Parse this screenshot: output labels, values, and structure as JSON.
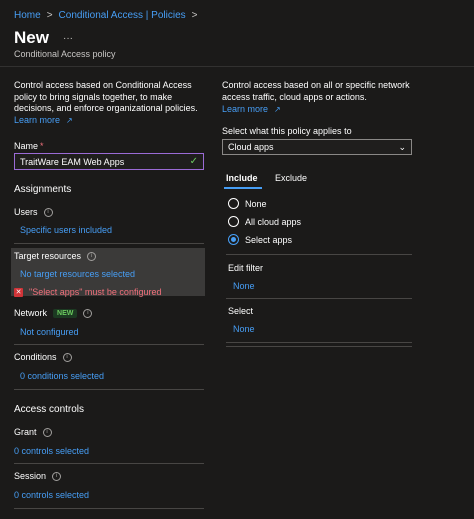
{
  "breadcrumb": {
    "home": "Home",
    "sep1": ">",
    "section": "Conditional Access | Policies",
    "sep2": ">"
  },
  "header": {
    "title": "New",
    "more": "···",
    "subtitle": "Conditional Access policy"
  },
  "left": {
    "intro": "Control access based on Conditional Access policy to bring signals together, to make decisions, and enforce organizational policies.",
    "learn_more": "Learn more",
    "name_label": "Name",
    "name_required": "*",
    "name_value": "TraitWare EAM Web Apps",
    "assignments": "Assignments",
    "users_label": "Users",
    "users_value": "Specific users included",
    "target_label": "Target resources",
    "target_value": "No target resources selected",
    "target_error": "\"Select apps\" must be configured",
    "network_label": "Network",
    "network_badge": "NEW",
    "network_value": "Not configured",
    "conditions_label": "Conditions",
    "conditions_value": "0 conditions selected",
    "access_controls": "Access controls",
    "grant_label": "Grant",
    "grant_value": "0 controls selected",
    "session_label": "Session",
    "session_value": "0 controls selected"
  },
  "right": {
    "intro": "Control access based on all or specific network access traffic, cloud apps or actions.",
    "learn_more": "Learn more",
    "applies_label": "Select what this policy applies to",
    "applies_value": "Cloud apps",
    "tab_include": "Include",
    "tab_exclude": "Exclude",
    "options": [
      "None",
      "All cloud apps",
      "Select apps"
    ],
    "selected_option": "Select apps",
    "edit_filter_label": "Edit filter",
    "edit_filter_value": "None",
    "select_label": "Select",
    "select_value": "None"
  },
  "colors": {
    "accent": "#479ef5",
    "error": "#f1707b",
    "success_badge": "#6ccb5f",
    "name_border": "#8a2be2"
  }
}
